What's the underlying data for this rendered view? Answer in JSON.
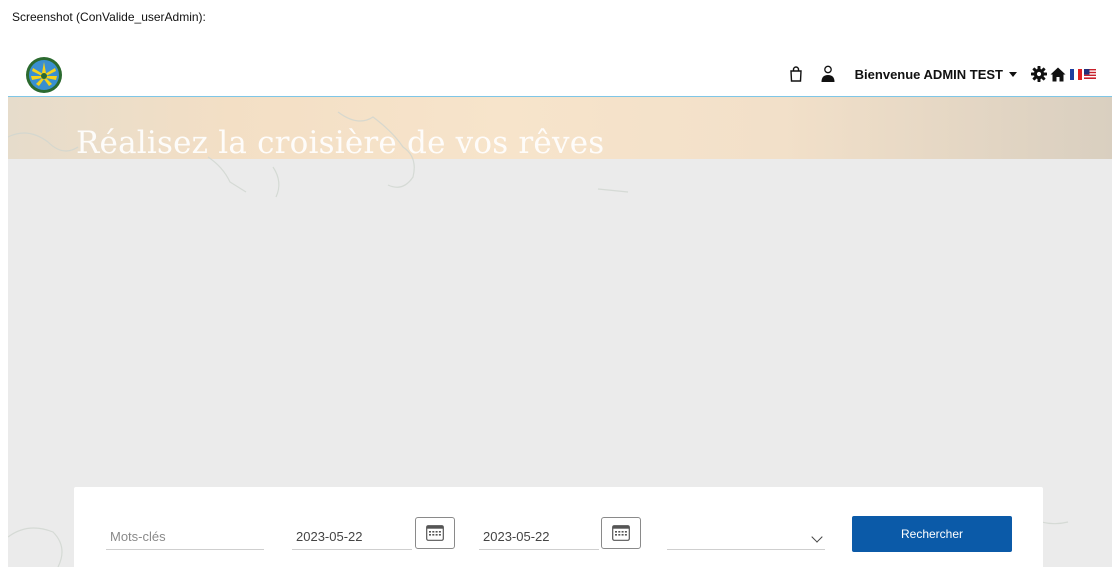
{
  "caption": "Screenshot (ConValide_userAdmin):",
  "header": {
    "welcome_label": "Bienvenue ADMIN TEST"
  },
  "hero": {
    "title": "Réalisez la croisière de vos rêves"
  },
  "search": {
    "keywords_placeholder": "Mots-clés",
    "date_from": "2023-05-22",
    "date_to": "2023-05-22",
    "select_value": "",
    "button_label": "Rechercher"
  },
  "colors": {
    "accent": "#0b5aa8",
    "header_border": "#7fc6e6",
    "hero_bg": "#ebebeb"
  },
  "icons": [
    "logo-emblem",
    "shopping-bag-icon",
    "user-icon",
    "gear-icon",
    "home-icon",
    "flag-fr-icon",
    "flag-us-icon",
    "calendar-icon",
    "chevron-down-icon"
  ]
}
